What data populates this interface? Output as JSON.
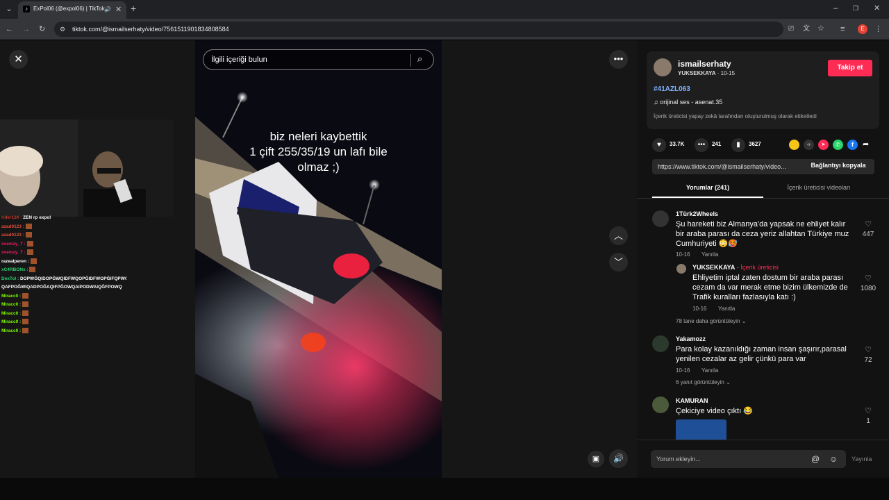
{
  "browser": {
    "tab_title": "ExPol06 (@expol06) | TikTok",
    "url": "tiktok.com/@ismailserhaty/video/7561511901834808584"
  },
  "video": {
    "search_placeholder": "İlgili içeriği bulun",
    "caption_lines": [
      "biz neleri kaybettik",
      "1 çift 255/35/19 un lafı bile",
      "olmaz ;)"
    ]
  },
  "stream_chat": [
    {
      "user": "rider124",
      "text": "ZEN rp expol",
      "color": "#c0392b"
    },
    {
      "user": "azad0123",
      "text": "",
      "color": "#e74c3c"
    },
    {
      "user": "azad0123",
      "text": "",
      "color": "#e74c3c"
    },
    {
      "user": "svemzy_7",
      "text": "",
      "color": "#e91e63"
    },
    {
      "user": "svemzy_7",
      "text": "",
      "color": "#e91e63"
    },
    {
      "user": "razealperen",
      "text": "",
      "color": "#ffffff"
    },
    {
      "user": "xC4RBONx",
      "text": "",
      "color": "#2ecc71"
    },
    {
      "user": "DexTol",
      "text": "DOPWĞQIDOPĞWQIDFWQOPĞIDFWOPĞIFQPWĞQAIF",
      "color": "#2ecc71"
    },
    {
      "user": "",
      "text": "QAFPOĞWIQADPOĞAQIFPĞOWQAIPODWAIQĞFPOWQ",
      "color": "#ffffff"
    },
    {
      "user": "Miracc0",
      "text": "",
      "color": "#7cfc00"
    },
    {
      "user": "Miracc0",
      "text": "",
      "color": "#7cfc00"
    },
    {
      "user": "Miracc0",
      "text": "",
      "color": "#7cfc00"
    },
    {
      "user": "Miracc0",
      "text": "",
      "color": "#7cfc00"
    },
    {
      "user": "Miracc0",
      "text": "",
      "color": "#7cfc00"
    }
  ],
  "author": {
    "username": "ismailserhaty",
    "display": "YUKSEKKAYA",
    "date": "10-15",
    "follow_label": "Takip et",
    "hashtag": "#41AZL063",
    "sound": "orijinal ses - asenat.35",
    "ai_label": "İçerik üreticisi yapay zekâ tarafından oluşturulmuş olarak etiketledi"
  },
  "stats": {
    "likes": "33.7K",
    "comments": "241",
    "saves": "3627"
  },
  "link": {
    "url": "https://www.tiktok.com/@ismailserhaty/video...",
    "copy_label": "Bağlantıyı kopyala"
  },
  "tabs": {
    "comments": "Yorumlar (241)",
    "creator_videos": "İçerik üreticisi videoları"
  },
  "comments": [
    {
      "user": "1Türk2Wheels",
      "text": "Şu hareketi biz Almanya'da yapsak ne ehliyet kalır bir araba parası da ceza yeriz allahtan Türkiye muz Cumhuriyeti 😳🥵",
      "date": "10-16",
      "reply": "Yanıtla",
      "likes": "447",
      "replies": [
        {
          "user": "YUKSEKKAYA",
          "badge": "İçerik üreticisi",
          "text": "Ehliyetim iptal zaten dostum bir araba parası cezam da var merak etme bizim ülkemizde de Trafik kuralları fazlasıyla katı :)",
          "date": "10-16",
          "reply": "Yanıtla",
          "likes": "1080"
        }
      ],
      "more": "78 tane daha görüntüleyin"
    },
    {
      "user": "Yakamozz",
      "text": "Para kolay kazanıldığı zaman insan şaşırır,parasal yenilen cezalar az gelir çünkü para var",
      "date": "10-16",
      "reply": "Yanıtla",
      "likes": "72",
      "more": "6 yanıt görüntüleyin"
    },
    {
      "user": "KAMURAN",
      "text": "Çekiciye video çıktı 😂",
      "likes": "1"
    }
  ],
  "comment_box": {
    "placeholder": "Yorum ekleyin...",
    "post_label": "Yayınla"
  },
  "colors": {
    "accent": "#fe2c55",
    "hashtag": "#7fb2ff",
    "background": "#121212"
  }
}
